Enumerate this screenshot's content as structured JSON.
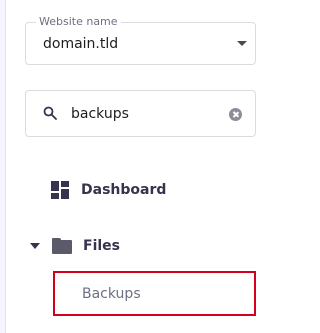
{
  "website_select": {
    "legend": "Website name",
    "value": "domain.tld"
  },
  "search": {
    "value": "backups",
    "icon": "search-icon",
    "clear_icon": "clear-icon"
  },
  "nav": {
    "dashboard": {
      "label": "Dashboard",
      "icon": "dashboard-icon"
    },
    "files": {
      "label": "Files",
      "icon": "folder-icon",
      "expanded": true
    },
    "files_children": [
      {
        "label": "Backups",
        "highlighted": true
      }
    ]
  },
  "colors": {
    "highlight_border": "#d6001c",
    "nav_text": "#36344d",
    "sub_text": "#6d7081"
  }
}
